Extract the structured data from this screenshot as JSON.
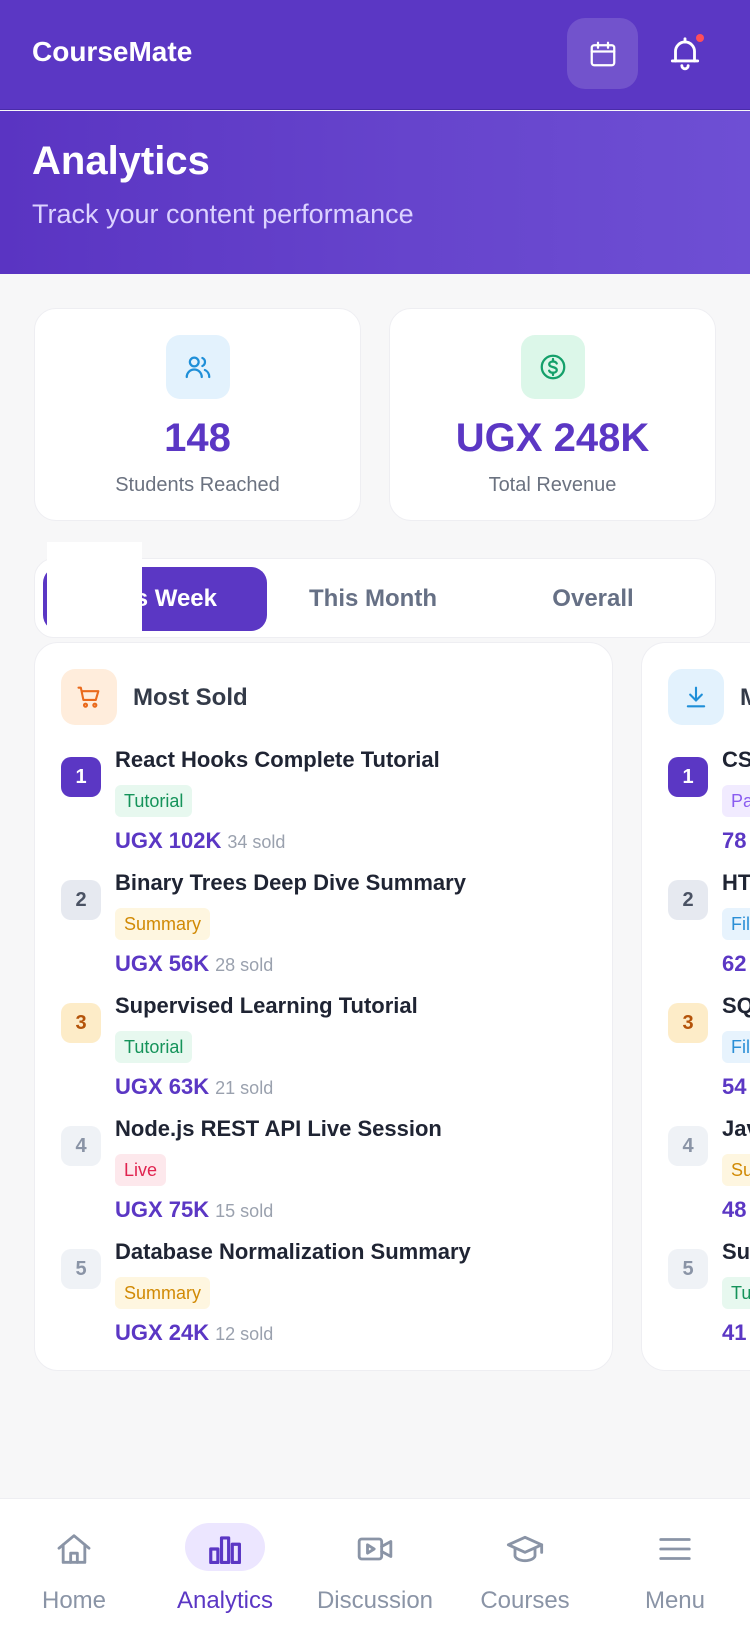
{
  "app": {
    "brand": "CourseMate",
    "colors": {
      "primary": "#5b37c4",
      "notification_dot": "#ff4d5a"
    },
    "icons": {
      "calendar": "calendar-icon",
      "bell": "bell-icon"
    }
  },
  "hero": {
    "title": "Analytics",
    "subtitle": "Track your content performance"
  },
  "stats": [
    {
      "value": "148",
      "label": "Students Reached",
      "icon": "users-icon"
    },
    {
      "value": "UGX 248K",
      "label": "Total Revenue",
      "icon": "dollar-circle-icon"
    }
  ],
  "period_tabs": {
    "items": [
      "s Week",
      "This Month",
      "Overall"
    ],
    "active_index": 0
  },
  "cards": [
    {
      "title": "Most Sold",
      "icon": "cart-icon",
      "items": [
        {
          "rank": "1",
          "title": "React Hooks Complete Tutorial",
          "tag": "Tutorial",
          "price": "UGX 102K",
          "sold": "34 sold"
        },
        {
          "rank": "2",
          "title": "Binary Trees Deep Dive Summary",
          "tag": "Summary",
          "price": "UGX 56K",
          "sold": "28 sold"
        },
        {
          "rank": "3",
          "title": "Supervised Learning Tutorial",
          "tag": "Tutorial",
          "price": "UGX 63K",
          "sold": "21 sold"
        },
        {
          "rank": "4",
          "title": "Node.js REST API Live Session",
          "tag": "Live",
          "price": "UGX 75K",
          "sold": "15 sold"
        },
        {
          "rank": "5",
          "title": "Database Normalization Summary",
          "tag": "Summary",
          "price": "UGX 24K",
          "sold": "12 sold"
        }
      ]
    },
    {
      "title": "M",
      "icon": "download-icon",
      "items": [
        {
          "rank": "1",
          "title": "CS",
          "tag": "Pa",
          "price": "78"
        },
        {
          "rank": "2",
          "title": "HT",
          "tag": "Fil",
          "price": "62"
        },
        {
          "rank": "3",
          "title": "SQ",
          "tag": "Fil",
          "price": "54"
        },
        {
          "rank": "4",
          "title": "Jav",
          "tag": "Su",
          "price": "48"
        },
        {
          "rank": "5",
          "title": "Su",
          "tag": "Tu",
          "price": "41"
        }
      ]
    }
  ],
  "bottom_nav": [
    {
      "label": "Home",
      "icon": "home-icon"
    },
    {
      "label": "Analytics",
      "icon": "bar-chart-icon",
      "active": true
    },
    {
      "label": "Discussion",
      "icon": "video-icon"
    },
    {
      "label": "Courses",
      "icon": "graduation-cap-icon"
    },
    {
      "label": "Menu",
      "icon": "menu-icon"
    }
  ]
}
